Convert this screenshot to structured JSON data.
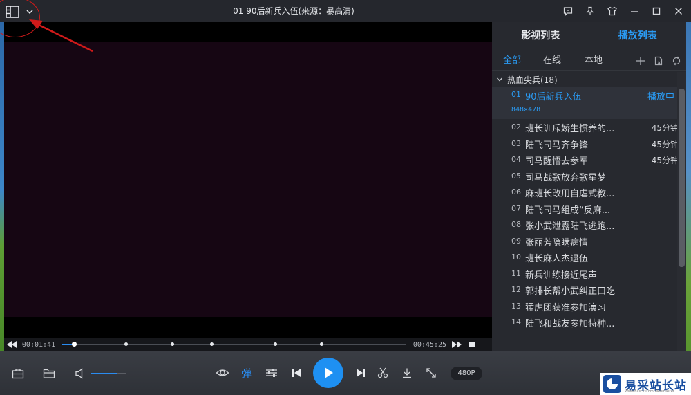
{
  "window": {
    "title": "01 90后新兵入伍(来源：暴高清)"
  },
  "playback": {
    "elapsed": "00:01:41",
    "total": "00:45:25",
    "progress_fraction": 0.035,
    "chapter_marks": [
      0.035,
      0.185,
      0.32,
      0.435,
      0.62,
      0.755
    ],
    "volume_fraction": 0.75,
    "danmaku_label": "弹",
    "quality": "480P"
  },
  "panel": {
    "tabs": [
      {
        "label": "影视列表",
        "active": false
      },
      {
        "label": "播放列表",
        "active": true
      }
    ],
    "subtabs": [
      {
        "label": "全部",
        "active": true
      },
      {
        "label": "在线",
        "active": false
      },
      {
        "label": "本地",
        "active": false
      }
    ],
    "group": {
      "label": "热血尖兵(18)"
    },
    "current": {
      "num": "01",
      "title": "90后新兵入伍",
      "status": "播放中",
      "resolution": "848×478"
    },
    "episodes": [
      {
        "num": "02",
        "title": "班长训斥娇生惯养的...",
        "duration": "45分钟"
      },
      {
        "num": "03",
        "title": "陆飞司马齐争锋",
        "duration": "45分钟"
      },
      {
        "num": "04",
        "title": "司马醒悟去参军",
        "duration": "45分钟"
      },
      {
        "num": "05",
        "title": "司马战歌放弃歌星梦",
        "duration": ""
      },
      {
        "num": "06",
        "title": "麻班长改用自虐式教...",
        "duration": ""
      },
      {
        "num": "07",
        "title": "陆飞司马组成“反麻...",
        "duration": ""
      },
      {
        "num": "08",
        "title": "张小武泄露陆飞逃跑...",
        "duration": ""
      },
      {
        "num": "09",
        "title": "张丽芳隐瞒病情",
        "duration": ""
      },
      {
        "num": "10",
        "title": "班长麻人杰退伍",
        "duration": ""
      },
      {
        "num": "11",
        "title": "新兵训练接近尾声",
        "duration": ""
      },
      {
        "num": "12",
        "title": "郭排长帮小武纠正口吃",
        "duration": ""
      },
      {
        "num": "13",
        "title": "猛虎团获准参加演习",
        "duration": ""
      },
      {
        "num": "14",
        "title": "陆飞和战友参加特种...",
        "duration": ""
      }
    ]
  },
  "watermark": {
    "text": "易采站长站",
    "sub": "Www.Easck.Com Webmaster"
  },
  "colors": {
    "accent": "#2a9cf5",
    "annotation": "#d11a1a"
  }
}
